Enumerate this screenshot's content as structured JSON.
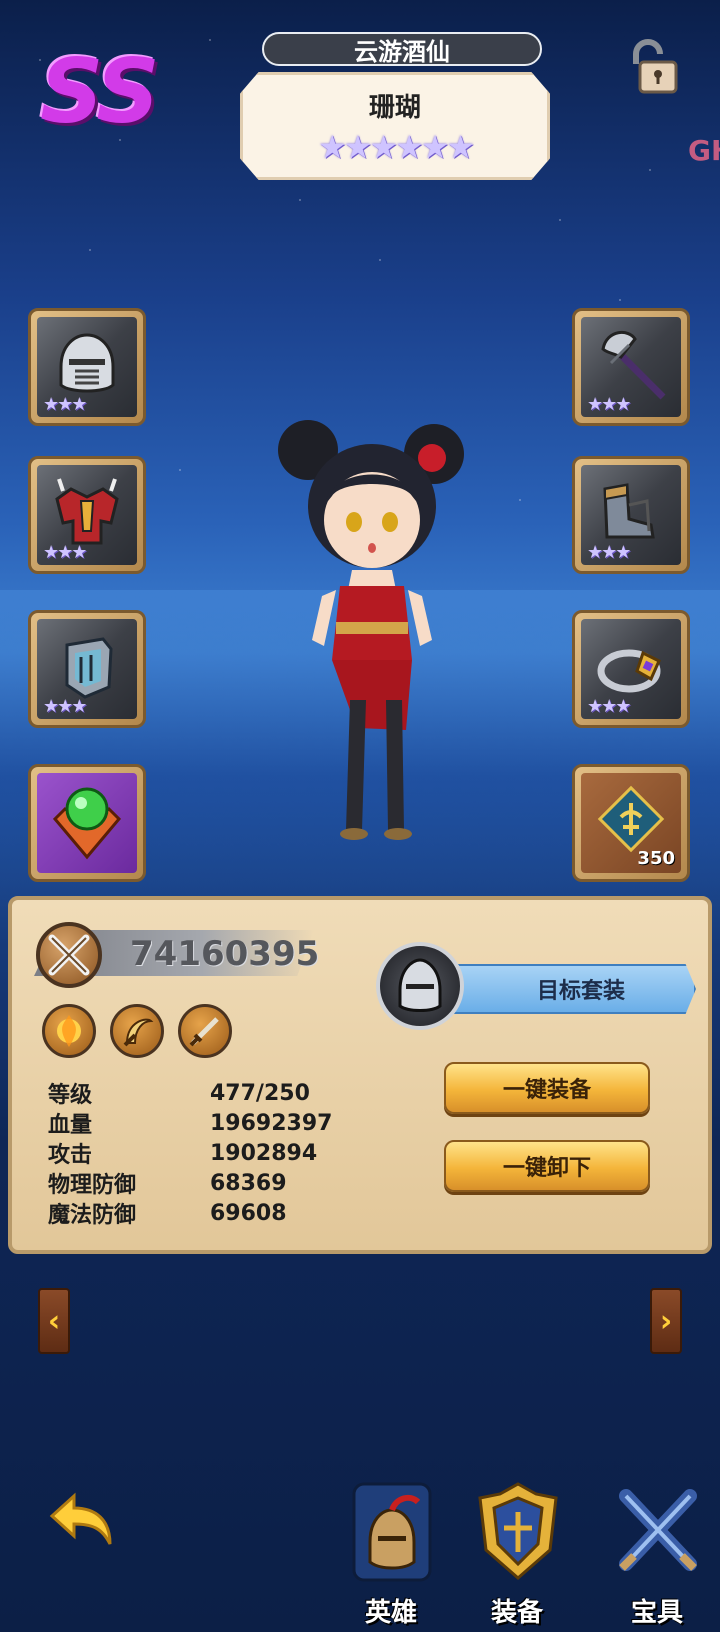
{
  "header": {
    "rank": "SS",
    "title": "云游酒仙",
    "hero_name": "珊瑚",
    "hero_stars": "★★★★★★",
    "side_tag": "GH"
  },
  "equipment": {
    "left": [
      {
        "name": "helmet",
        "stars": "★★★"
      },
      {
        "name": "armor",
        "stars": "★★★"
      },
      {
        "name": "gauntlet",
        "stars": "★★★"
      },
      {
        "name": "emblem"
      }
    ],
    "right": [
      {
        "name": "axe",
        "stars": "★★★"
      },
      {
        "name": "boots",
        "stars": "★★★"
      },
      {
        "name": "ring",
        "stars": "★★★"
      },
      {
        "name": "rune",
        "count": "350"
      }
    ]
  },
  "panel": {
    "power": "74160395",
    "target_set_label": "目标套装",
    "equip_all_label": "一键装备",
    "unequip_all_label": "一键卸下",
    "stats": [
      {
        "label": "等级",
        "value": "477/250"
      },
      {
        "label": "血量",
        "value": "19692397"
      },
      {
        "label": "攻击",
        "value": "1902894"
      },
      {
        "label": "物理防御",
        "value": "68369"
      },
      {
        "label": "魔法防御",
        "value": "69608"
      }
    ]
  },
  "nav": {
    "prev": "‹",
    "next": "›",
    "items": [
      {
        "label": "英雄"
      },
      {
        "label": "装备"
      },
      {
        "label": "宝具"
      }
    ]
  },
  "colors": {
    "rank": "#d23be8",
    "gold_button": "#f4b53a",
    "target_ribbon": "#6aaee8"
  }
}
